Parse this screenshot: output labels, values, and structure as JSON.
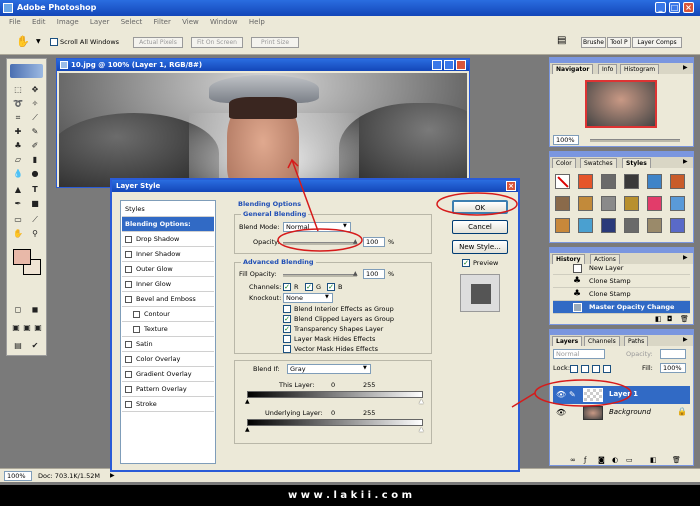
{
  "app": {
    "title": "Adobe Photoshop"
  },
  "menu": [
    "File",
    "Edit",
    "Image",
    "Layer",
    "Select",
    "Filter",
    "View",
    "Window",
    "Help"
  ],
  "options": {
    "scroll_all": "Scroll All Windows",
    "actual_pixels": "Actual Pixels",
    "fit_on_screen": "Fit On Screen",
    "print_size": "Print Size",
    "well_tabs": [
      "Brushe",
      "Tool P",
      "Layer Comps"
    ]
  },
  "document": {
    "title": "10.jpg @ 100% (Layer 1, RGB/8#)"
  },
  "status": {
    "zoom": "100%",
    "doc": "Doc: 703.1K/1.52M"
  },
  "navigator": {
    "tabs": [
      "Navigator",
      "Info",
      "Histogram"
    ],
    "zoom": "100%"
  },
  "swatches": {
    "tabs": [
      "Color",
      "Swatches",
      "Styles"
    ]
  },
  "history": {
    "tabs": [
      "History",
      "Actions"
    ],
    "items": [
      "New Layer",
      "Clone Stamp",
      "Clone Stamp",
      "Master Opacity Change"
    ]
  },
  "layers": {
    "tabs": [
      "Layers",
      "Channels",
      "Paths"
    ],
    "mode": "Normal",
    "opacity_label": "Opacity:",
    "lock_label": "Lock:",
    "fill_label": "Fill:",
    "fill_value": "100%",
    "items": [
      "Layer 1",
      "Background"
    ]
  },
  "dialog": {
    "title": "Layer Style",
    "styles_header": "Styles",
    "list": [
      "Blending Options: Default",
      "Drop Shadow",
      "Inner Shadow",
      "Outer Glow",
      "Inner Glow",
      "Bevel and Emboss",
      "Contour",
      "Texture",
      "Satin",
      "Color Overlay",
      "Gradient Overlay",
      "Pattern Overlay",
      "Stroke"
    ],
    "section": "Blending Options",
    "general": {
      "title": "General Blending",
      "mode_label": "Blend Mode:",
      "mode_value": "Normal",
      "opacity_label": "Opacity:",
      "opacity_value": "100",
      "pct": "%"
    },
    "advanced": {
      "title": "Advanced Blending",
      "fill_label": "Fill Opacity:",
      "fill_value": "100",
      "pct": "%",
      "channels_label": "Channels:",
      "ch_r": "R",
      "ch_g": "G",
      "ch_b": "B",
      "knockout_label": "Knockout:",
      "knockout_value": "None",
      "checks": [
        "Blend Interior Effects as Group",
        "Blend Clipped Layers as Group",
        "Transparency Shapes Layer",
        "Layer Mask Hides Effects",
        "Vector Mask Hides Effects"
      ]
    },
    "blendif": {
      "label": "Blend If:",
      "value": "Gray",
      "this_layer": "This Layer:",
      "underlying": "Underlying Layer:",
      "min": "0",
      "max": "255"
    },
    "buttons": {
      "ok": "OK",
      "cancel": "Cancel",
      "new_style": "New Style...",
      "preview": "Preview"
    }
  },
  "footer": {
    "text": "w w w . l a k i i . c o m"
  }
}
